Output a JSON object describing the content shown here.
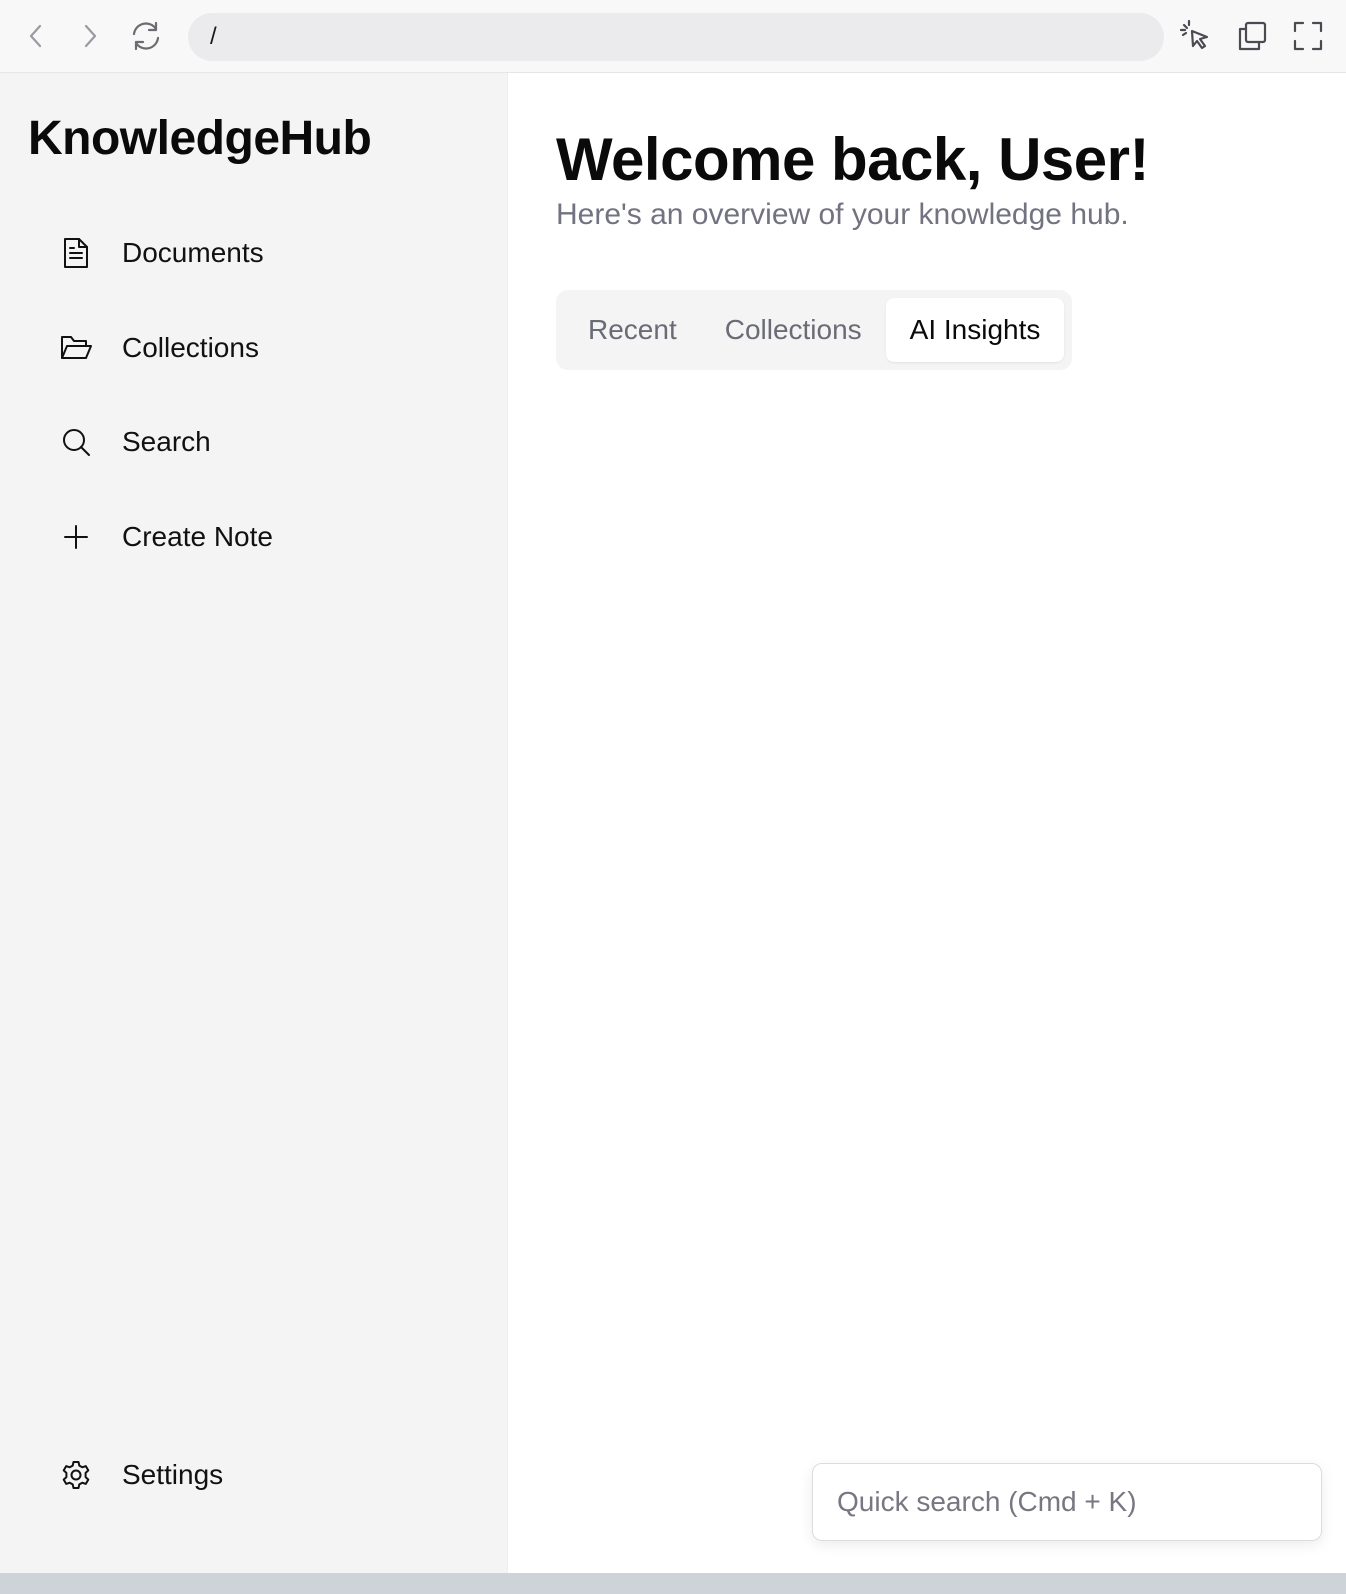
{
  "browser": {
    "url": "/",
    "icons": [
      "chevron-left-icon",
      "chevron-right-icon",
      "reload-icon",
      "pointer-select-icon",
      "copy-window-icon",
      "fullscreen-icon"
    ]
  },
  "sidebar": {
    "brand": "KnowledgeHub",
    "items": [
      {
        "label": "Documents",
        "icon": "document-icon"
      },
      {
        "label": "Collections",
        "icon": "folder-open-icon"
      },
      {
        "label": "Search",
        "icon": "search-icon"
      },
      {
        "label": "Create Note",
        "icon": "plus-icon"
      }
    ],
    "settings": {
      "label": "Settings",
      "icon": "gear-icon"
    }
  },
  "main": {
    "welcome": "Welcome back, User!",
    "subtitle": "Here's an overview of your knowledge hub.",
    "tabs": [
      {
        "label": "Recent",
        "active": false
      },
      {
        "label": "Collections",
        "active": false
      },
      {
        "label": "AI Insights",
        "active": true
      }
    ],
    "quick_search": {
      "placeholder": "Quick search (Cmd + K)",
      "value": ""
    }
  },
  "colors": {
    "sidebar_bg": "#f4f4f5",
    "main_bg": "#ffffff",
    "muted_text": "#727280",
    "text": "#0a0a0a"
  }
}
